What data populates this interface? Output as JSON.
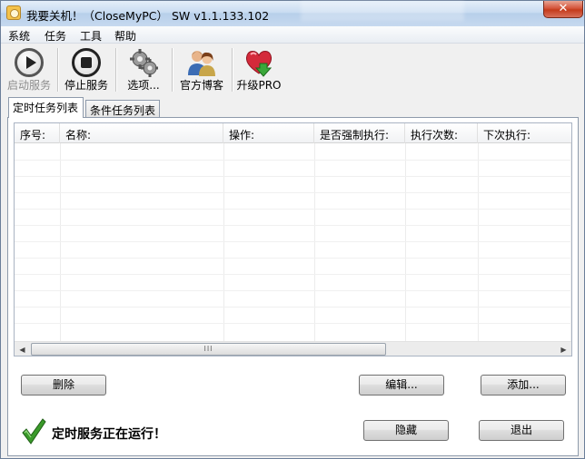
{
  "window": {
    "title": "我要关机！（CloseMyPC） SW v1.1.133.102",
    "close_glyph": "✕"
  },
  "menu": [
    "系统",
    "任务",
    "工具",
    "帮助"
  ],
  "toolbar": [
    {
      "label": "启动服务",
      "icon": "play-icon",
      "enabled": false
    },
    {
      "label": "停止服务",
      "icon": "stop-icon",
      "enabled": true
    },
    {
      "label": "选项...",
      "icon": "gears-icon",
      "enabled": true
    },
    {
      "label": "官方博客",
      "icon": "people-icon",
      "enabled": true
    },
    {
      "label": "升级PRO",
      "icon": "heart-upgrade-icon",
      "enabled": true
    }
  ],
  "tabs": [
    {
      "label": "定时任务列表",
      "active": true
    },
    {
      "label": "条件任务列表",
      "active": false
    }
  ],
  "list": {
    "columns": [
      "序号:",
      "名称:",
      "操作:",
      "是否强制执行:",
      "执行次数:",
      "下次执行:"
    ],
    "rows": [],
    "scroll_thumb_glyph": "III"
  },
  "buttons": {
    "delete": "删除",
    "edit": "编辑...",
    "add": "添加...",
    "hide": "隐藏",
    "exit": "退出"
  },
  "status": {
    "text": "定时服务正在运行！",
    "icon": "checkmark-icon"
  },
  "colors": {
    "check_green": "#3a9a2a",
    "heart_red": "#d42a3a",
    "arrow_green": "#3aa83a"
  }
}
